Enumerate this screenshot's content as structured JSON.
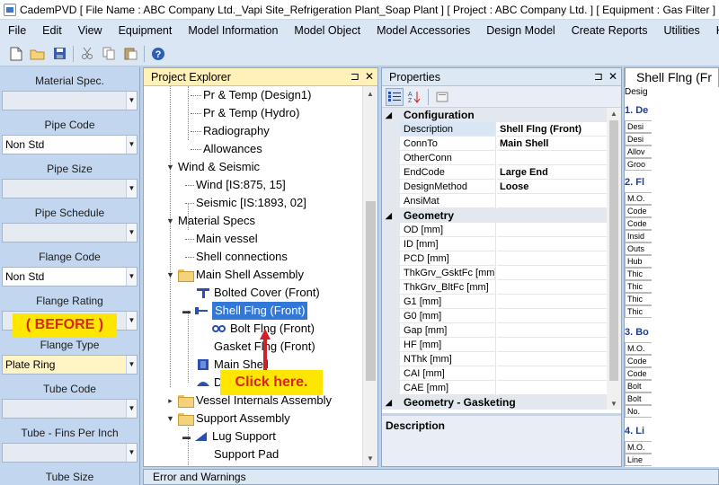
{
  "window": {
    "title": "CademPVD [ File Name : ABC Company Ltd._Vapi Site_Refrigeration Plant_Soap Plant ] [ Project : ABC Company Ltd. ] [ Equipment : Gas Filter ]"
  },
  "menu": [
    "File",
    "Edit",
    "View",
    "Equipment",
    "Model Information",
    "Model Object",
    "Model Accessories",
    "Design Model",
    "Create Reports",
    "Utilities",
    "He"
  ],
  "toolbar_icons": [
    "new-file-icon",
    "open-folder-icon",
    "save-icon",
    "cut-icon",
    "copy-icon",
    "paste-icon",
    "help-icon"
  ],
  "left_panel": {
    "fields": [
      {
        "label": "Material Spec.",
        "value": "",
        "style": "grey"
      },
      {
        "label": "Pipe Code",
        "value": "Non Std",
        "style": "white"
      },
      {
        "label": "Pipe Size",
        "value": "",
        "style": "grey"
      },
      {
        "label": "Pipe Schedule",
        "value": "",
        "style": "grey"
      },
      {
        "label": "Flange Code",
        "value": "Non Std",
        "style": "white"
      },
      {
        "label": "Flange Rating",
        "value": "",
        "style": "grey"
      },
      {
        "label": "Flange Type",
        "value": "Plate Ring",
        "style": "yellow"
      },
      {
        "label": "Tube Code",
        "value": "",
        "style": "grey"
      },
      {
        "label": "Tube - Fins Per Inch",
        "value": "",
        "style": "grey"
      },
      {
        "label": "Tube Size",
        "value": "",
        "style": "grey"
      }
    ],
    "before_badge": "( BEFORE )"
  },
  "project_explorer": {
    "title": "Project Explorer",
    "pin_icon": "pin-icon",
    "close_icon": "close-icon",
    "tree": [
      {
        "label": "Pr & Temp (Design1)"
      },
      {
        "label": "Pr & Temp (Hydro)"
      },
      {
        "label": "Radiography"
      },
      {
        "label": "Allowances"
      },
      {
        "label": "Wind & Seismic"
      },
      {
        "label": "Wind [IS:875, 15]"
      },
      {
        "label": "Seismic [IS:1893, 02]"
      },
      {
        "label": "Material Specs"
      },
      {
        "label": "Main vessel"
      },
      {
        "label": "Shell connections"
      },
      {
        "label": "Main Shell Assembly"
      },
      {
        "label": "Bolted Cover (Front)"
      },
      {
        "label": "Shell Flng (Front)"
      },
      {
        "label": "Bolt Flng (Front)"
      },
      {
        "label": "Gasket Flng (Front)"
      },
      {
        "label": "Main Shell"
      },
      {
        "label": "D"
      },
      {
        "label": "Vessel Internals Assembly"
      },
      {
        "label": "Support Assembly"
      },
      {
        "label": "Lug Support"
      },
      {
        "label": "Support Pad"
      }
    ],
    "callout": "Click here."
  },
  "properties": {
    "title": "Properties",
    "categories": [
      {
        "name": "Configuration",
        "rows": [
          {
            "name": "Description",
            "value": "Shell Flng (Front)"
          },
          {
            "name": "ConnTo",
            "value": "Main Shell"
          },
          {
            "name": "OtherConn",
            "value": ""
          },
          {
            "name": "EndCode",
            "value": "Large End"
          },
          {
            "name": "DesignMethod",
            "value": "Loose"
          },
          {
            "name": "AnsiMat",
            "value": ""
          }
        ]
      },
      {
        "name": "Geometry",
        "rows": [
          {
            "name": "OD [mm]",
            "value": ""
          },
          {
            "name": "ID [mm]",
            "value": ""
          },
          {
            "name": "PCD [mm]",
            "value": ""
          },
          {
            "name": "ThkGrv_GsktFc [mm]",
            "value": ""
          },
          {
            "name": "ThkGrv_BltFc [mm]",
            "value": ""
          },
          {
            "name": "G1 [mm]",
            "value": ""
          },
          {
            "name": "G0 [mm]",
            "value": ""
          },
          {
            "name": "Gap [mm]",
            "value": ""
          },
          {
            "name": "HF [mm]",
            "value": ""
          },
          {
            "name": "NThk [mm]",
            "value": ""
          },
          {
            "name": "CAI [mm]",
            "value": ""
          },
          {
            "name": "CAE [mm]",
            "value": ""
          }
        ]
      },
      {
        "name": "Geometry - Gasketing",
        "rows": []
      }
    ],
    "description_label": "Description"
  },
  "document": {
    "tab_title": "Shell Flng (Fr",
    "top": "Desig",
    "sections": [
      {
        "title": "1. De",
        "cells": [
          "Desi",
          "Desi",
          "Allov",
          "Groo"
        ]
      },
      {
        "title": "2. Fl",
        "cells": [
          "M.O.",
          "Code",
          "Code",
          "Insid",
          "Outs",
          "Hub",
          "Thic",
          "Thic",
          "Thic",
          "Thic"
        ]
      },
      {
        "title": "3. Bo",
        "cells": [
          "M.O.",
          "Code",
          "Code",
          "Bolt",
          "Bolt",
          "No. "
        ]
      },
      {
        "title": "4. Li",
        "cells": [
          "M.O.",
          "Line"
        ]
      }
    ]
  },
  "error_bar": "Error and Warnings"
}
